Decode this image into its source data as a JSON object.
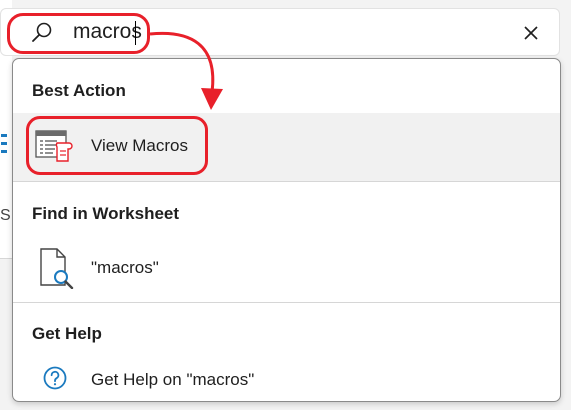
{
  "search": {
    "query": "macros"
  },
  "dropdown": {
    "sections": [
      {
        "header": "Best Action",
        "items": [
          {
            "label": "View Macros",
            "icon": "view-macros-icon"
          }
        ]
      },
      {
        "header": "Find in Worksheet",
        "items": [
          {
            "label": "\"macros\"",
            "icon": "find-document-icon"
          }
        ]
      },
      {
        "header": "Get Help",
        "items": [
          {
            "label": "Get Help on \"macros\"",
            "icon": "help-icon"
          }
        ]
      }
    ]
  },
  "background": {
    "fragment_text": "Sc"
  },
  "colors": {
    "annotation": "#e8202a",
    "accent": "#1b7abf",
    "selected_row": "#f1f1f1"
  }
}
